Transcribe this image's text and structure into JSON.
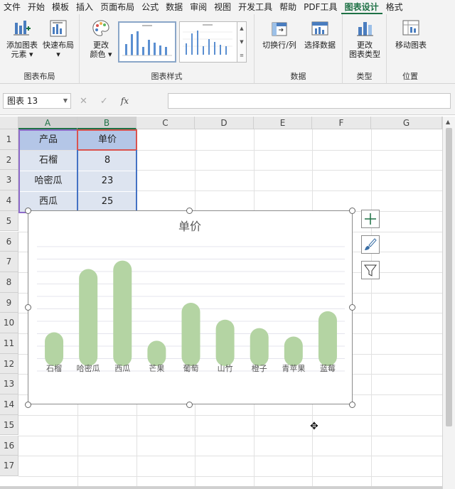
{
  "menu_tabs": [
    "文件",
    "开始",
    "模板",
    "插入",
    "页面布局",
    "公式",
    "数据",
    "审阅",
    "视图",
    "开发工具",
    "帮助",
    "PDF工具",
    "图表设计",
    "格式"
  ],
  "active_tab": "图表设计",
  "ribbon": {
    "groups": {
      "layout": "图表布局",
      "styles": "图表样式",
      "data": "数据",
      "type": "类型",
      "location": "位置"
    },
    "buttons": {
      "add_element_1": "添加图表",
      "add_element_2": "元素",
      "quick_layout": "快速布局",
      "change_colors_1": "更改",
      "change_colors_2": "颜色",
      "switch_row_col": "切换行/列",
      "select_data": "选择数据",
      "change_type_1": "更改",
      "change_type_2": "图表类型",
      "move_chart": "移动图表"
    }
  },
  "formula_bar": {
    "name_box": "图表 13",
    "cancel_icon": "✕",
    "confirm_icon": "✓",
    "fx_label": "fx",
    "formula": ""
  },
  "columns": [
    "A",
    "B",
    "C",
    "D",
    "E",
    "F",
    "G"
  ],
  "rows": [
    "1",
    "2",
    "3",
    "4",
    "5",
    "6",
    "7",
    "8",
    "9",
    "10",
    "11",
    "12",
    "13",
    "14",
    "15",
    "16",
    "17"
  ],
  "table": {
    "header_product": "产品",
    "header_price": "单价",
    "rows": [
      {
        "product": "石榴",
        "price": "8"
      },
      {
        "product": "哈密瓜",
        "price": "23"
      },
      {
        "product": "西瓜",
        "price": "25"
      }
    ]
  },
  "colors": {
    "accent": "#1e7145",
    "bar": "#b4d4a3",
    "header_fill": "#b4c6e7",
    "cell_fill": "#dde4f0"
  },
  "chart_data": {
    "type": "bar",
    "title": "单价",
    "categories": [
      "石榴",
      "哈密瓜",
      "西瓜",
      "芒果",
      "葡萄",
      "山竹",
      "橙子",
      "青苹果",
      "蓝莓"
    ],
    "values": [
      8,
      23,
      25,
      6,
      15,
      11,
      9,
      7,
      13
    ],
    "ylim": [
      0,
      30
    ],
    "grid": true,
    "legend": "none",
    "bar_style": "rounded"
  }
}
